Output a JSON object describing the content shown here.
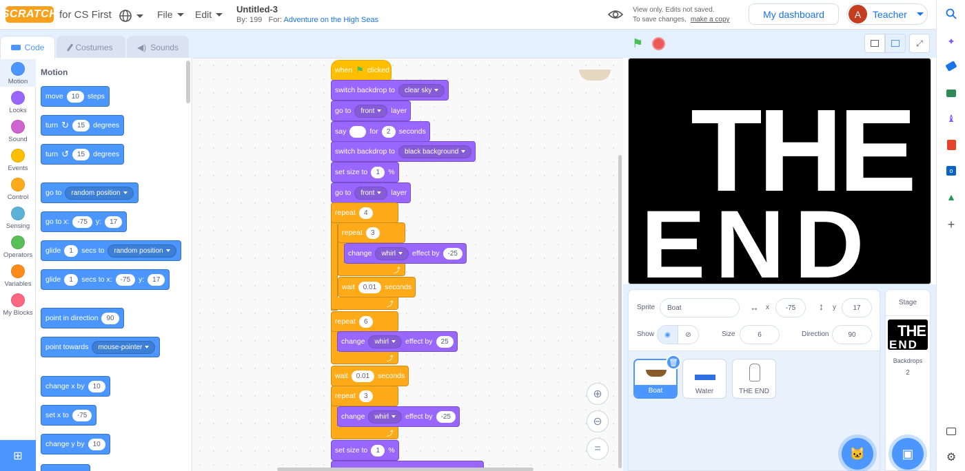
{
  "topbar": {
    "logo": "SCRATCH",
    "product": "for CS First",
    "menus": [
      "File",
      "Edit"
    ],
    "project_title": "Untitled-3",
    "by_label": "By: 199",
    "for_label": "For:",
    "for_link": "Adventure on the High Seas",
    "viewonly_line1": "View only. Edits not saved.",
    "viewonly_line2": "To save changes,",
    "make_copy": "make a copy",
    "dashboard_button": "My dashboard",
    "avatar_letter": "A",
    "account_name": "Teacher"
  },
  "tabs": [
    "Code",
    "Costumes",
    "Sounds"
  ],
  "categories": [
    {
      "label": "Motion",
      "color": "#4c97ff"
    },
    {
      "label": "Looks",
      "color": "#9966ff"
    },
    {
      "label": "Sound",
      "color": "#cf63cf"
    },
    {
      "label": "Events",
      "color": "#ffbf00"
    },
    {
      "label": "Control",
      "color": "#ffab19"
    },
    {
      "label": "Sensing",
      "color": "#5cb1d6"
    },
    {
      "label": "Operators",
      "color": "#59c059"
    },
    {
      "label": "Variables",
      "color": "#ff8c1a"
    },
    {
      "label": "My Blocks",
      "color": "#ff6680"
    }
  ],
  "palette": {
    "title": "Motion",
    "move": {
      "a": "move",
      "v": "10",
      "b": "steps"
    },
    "turn_right": {
      "a": "turn",
      "v": "15",
      "b": "degrees"
    },
    "turn_left": {
      "a": "turn",
      "v": "15",
      "b": "degrees"
    },
    "goto": {
      "a": "go to",
      "dd": "random position"
    },
    "gotoxy": {
      "a": "go to x:",
      "x": "-75",
      "b": "y:",
      "y": "17"
    },
    "glide": {
      "a": "glide",
      "v": "1",
      "b": "secs to",
      "dd": "random position"
    },
    "glidexy": {
      "a": "glide",
      "v": "1",
      "b": "secs to x:",
      "x": "-75",
      "c": "y:",
      "y": "17"
    },
    "point_dir": {
      "a": "point in direction",
      "v": "90"
    },
    "point_towards": {
      "a": "point towards",
      "dd": "mouse-pointer"
    },
    "change_x": {
      "a": "change x by",
      "v": "10"
    },
    "set_x": {
      "a": "set x to",
      "v": "-75"
    },
    "change_y": {
      "a": "change y by",
      "v": "10"
    }
  },
  "script": {
    "hat": {
      "a": "when",
      "b": "clicked"
    },
    "b1": {
      "a": "switch backdrop to",
      "dd": "clear sky"
    },
    "b2": {
      "a": "go to",
      "dd": "front",
      "b": "layer"
    },
    "b3": {
      "a": "say",
      "v": "",
      "b": "for",
      "v2": "2",
      "c": "seconds"
    },
    "b4": {
      "a": "switch backdrop to",
      "dd": "black background"
    },
    "b5": {
      "a": "set size to",
      "v": "1",
      "b": "%"
    },
    "b6": {
      "a": "go to",
      "dd": "front",
      "b": "layer"
    },
    "r1": {
      "a": "repeat",
      "v": "4"
    },
    "r1a": {
      "a": "repeat",
      "v": "3"
    },
    "r1a_b": {
      "a": "change",
      "dd": "whirl",
      "b": "effect by",
      "v": "-25"
    },
    "r1_wait": {
      "a": "wait",
      "v": "0.01",
      "b": "seconds"
    },
    "r2": {
      "a": "repeat",
      "v": "6"
    },
    "r2_b": {
      "a": "change",
      "dd": "whirl",
      "b": "effect by",
      "v": "25"
    },
    "wait2": {
      "a": "wait",
      "v": "0.01",
      "b": "seconds"
    },
    "r3": {
      "a": "repeat",
      "v": "3"
    },
    "r3_b": {
      "a": "change",
      "dd": "whirl",
      "b": "effect by",
      "v": "-25"
    },
    "b_end": {
      "a": "set size to",
      "v": "1",
      "b": "%"
    }
  },
  "stage": {
    "text_line1": "THE",
    "text_line2": "END"
  },
  "sprite_info": {
    "sprite_label": "Sprite",
    "sprite_name": "Boat",
    "x_label": "x",
    "x": "-75",
    "y_label": "y",
    "y": "17",
    "show_label": "Show",
    "size_label": "Size",
    "size": "6",
    "direction_label": "Direction",
    "direction": "90"
  },
  "sprites": [
    "Boat",
    "Water",
    "THE END"
  ],
  "stage_panel": {
    "title": "Stage",
    "backdrops_label": "Backdrops",
    "backdrops_count": "2"
  }
}
